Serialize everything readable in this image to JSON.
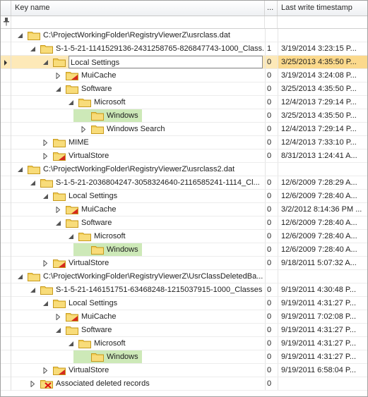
{
  "columns": {
    "key_name": "Key name",
    "values_count": "...",
    "last_write": "Last write timestamp"
  },
  "filter": {
    "pin_icon": "pin-icon"
  },
  "colors": {
    "selected_row": "#fde9b8",
    "highlight": "#cde9b8",
    "folder": "#f3cf5a"
  },
  "rows": [
    {
      "level": 0,
      "expander": "expanded",
      "icon": "folder",
      "name": "C:\\ProjectWorkingFolder\\RegistryViewerZ\\usrclass.dat",
      "count": "",
      "ts": ""
    },
    {
      "level": 1,
      "expander": "expanded",
      "icon": "folder",
      "name": "S-1-5-21-1141529136-2431258765-826847743-1000_Class...",
      "count": "1",
      "ts": "3/19/2014 3:23:15 P..."
    },
    {
      "level": 2,
      "expander": "expanded",
      "icon": "folder",
      "name": "Local Settings",
      "count": "0",
      "ts": "3/25/2013 4:35:50 P...",
      "selected": true,
      "editing": true
    },
    {
      "level": 3,
      "expander": "collapsed",
      "icon": "folder-red",
      "name": "MuiCache",
      "count": "0",
      "ts": "3/19/2014 3:24:08 P..."
    },
    {
      "level": 3,
      "expander": "expanded",
      "icon": "folder",
      "name": "Software",
      "count": "0",
      "ts": "3/25/2013 4:35:50 P..."
    },
    {
      "level": 4,
      "expander": "expanded",
      "icon": "folder",
      "name": "Microsoft",
      "count": "0",
      "ts": "12/4/2013 7:29:14 P..."
    },
    {
      "level": 5,
      "expander": "collapsed",
      "icon": "folder",
      "name": "Windows",
      "count": "0",
      "ts": "3/25/2013 4:35:50 P...",
      "highlight": true
    },
    {
      "level": 5,
      "expander": "collapsed",
      "icon": "folder",
      "name": "Windows Search",
      "count": "0",
      "ts": "12/4/2013 7:29:14 P..."
    },
    {
      "level": 2,
      "expander": "collapsed",
      "icon": "folder",
      "name": "MIME",
      "count": "0",
      "ts": "12/4/2013 7:33:10 P..."
    },
    {
      "level": 2,
      "expander": "collapsed",
      "icon": "folder-red",
      "name": "VirtualStore",
      "count": "0",
      "ts": "8/31/2013 1:24:41 A..."
    },
    {
      "level": 0,
      "expander": "expanded",
      "icon": "folder",
      "name": "C:\\ProjectWorkingFolder\\RegistryViewerZ\\usrclass2.dat",
      "count": "",
      "ts": ""
    },
    {
      "level": 1,
      "expander": "expanded",
      "icon": "folder",
      "name": "S-1-5-21-2036804247-3058324640-2116585241-1114_Cl...",
      "count": "0",
      "ts": "12/6/2009 7:28:29 A..."
    },
    {
      "level": 2,
      "expander": "expanded",
      "icon": "folder",
      "name": "Local Settings",
      "count": "0",
      "ts": "12/6/2009 7:28:40 A..."
    },
    {
      "level": 3,
      "expander": "collapsed",
      "icon": "folder-red",
      "name": "MuiCache",
      "count": "0",
      "ts": "3/2/2012 8:14:36 PM ..."
    },
    {
      "level": 3,
      "expander": "expanded",
      "icon": "folder",
      "name": "Software",
      "count": "0",
      "ts": "12/6/2009 7:28:40 A..."
    },
    {
      "level": 4,
      "expander": "expanded",
      "icon": "folder",
      "name": "Microsoft",
      "count": "0",
      "ts": "12/6/2009 7:28:40 A..."
    },
    {
      "level": 5,
      "expander": "collapsed",
      "icon": "folder",
      "name": "Windows",
      "count": "0",
      "ts": "12/6/2009 7:28:40 A...",
      "highlight": true
    },
    {
      "level": 2,
      "expander": "collapsed",
      "icon": "folder-red",
      "name": "VirtualStore",
      "count": "0",
      "ts": "9/18/2011 5:07:32 A..."
    },
    {
      "level": 0,
      "expander": "expanded",
      "icon": "folder",
      "name": "C:\\ProjectWorkingFolder\\RegistryViewerZ\\UsrClassDeletedBa...",
      "count": "",
      "ts": ""
    },
    {
      "level": 1,
      "expander": "expanded",
      "icon": "folder",
      "name": "S-1-5-21-146151751-63468248-1215037915-1000_Classes",
      "count": "0",
      "ts": "9/19/2011 4:30:48 P..."
    },
    {
      "level": 2,
      "expander": "expanded",
      "icon": "folder",
      "name": "Local Settings",
      "count": "0",
      "ts": "9/19/2011 4:31:27 P..."
    },
    {
      "level": 3,
      "expander": "collapsed",
      "icon": "folder-red",
      "name": "MuiCache",
      "count": "0",
      "ts": "9/19/2011 7:02:08 P..."
    },
    {
      "level": 3,
      "expander": "expanded",
      "icon": "folder",
      "name": "Software",
      "count": "0",
      "ts": "9/19/2011 4:31:27 P..."
    },
    {
      "level": 4,
      "expander": "expanded",
      "icon": "folder",
      "name": "Microsoft",
      "count": "0",
      "ts": "9/19/2011 4:31:27 P..."
    },
    {
      "level": 5,
      "expander": "collapsed",
      "icon": "folder",
      "name": "Windows",
      "count": "0",
      "ts": "9/19/2011 4:31:27 P...",
      "highlight": true
    },
    {
      "level": 2,
      "expander": "collapsed",
      "icon": "folder-red",
      "name": "VirtualStore",
      "count": "0",
      "ts": "9/19/2011 6:58:04 P..."
    },
    {
      "level": 1,
      "expander": "collapsed",
      "icon": "folder-deleted",
      "name": "Associated deleted records",
      "count": "0",
      "ts": ""
    }
  ]
}
